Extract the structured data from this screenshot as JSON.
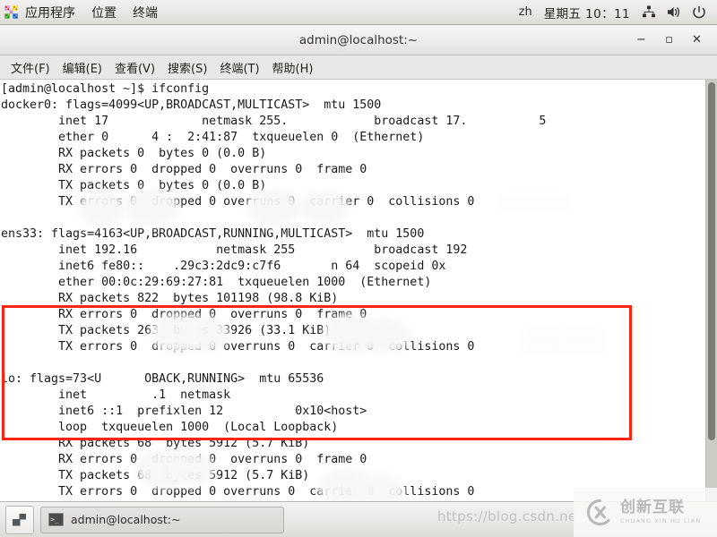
{
  "top_panel": {
    "apps_icon": "applications-pinwheel-icon",
    "menus": [
      "应用程序",
      "位置",
      "终端"
    ],
    "ime": "zh",
    "clock": "星期五 10：11",
    "tray": [
      {
        "name": "network-icon",
        "glyph": "network"
      },
      {
        "name": "volume-icon",
        "glyph": "volume"
      },
      {
        "name": "power-icon",
        "glyph": "power"
      }
    ]
  },
  "window": {
    "title": "admin@localhost:~",
    "controls": {
      "minimize": "−",
      "maximize": "▫",
      "close": "✕"
    },
    "menubar": [
      "文件(F)",
      "编辑(E)",
      "查看(V)",
      "搜索(S)",
      "终端(T)",
      "帮助(H)"
    ]
  },
  "terminal": {
    "prompt_line": "[admin@localhost ~]$ ifconfig",
    "lines": [
      "[admin@localhost ~]$ ifconfig",
      "docker0: flags=4099<UP,BROADCAST,MULTICAST>  mtu 1500",
      "        inet 17             netmask 255.            broadcast 17.          5",
      "        ether 0      4 :  2:41:87  txqueuelen 0  (Ethernet)",
      "        RX packets 0  bytes 0 (0.0 B)",
      "        RX errors 0  dropped 0  overruns 0  frame 0",
      "        TX packets 0  bytes 0 (0.0 B)",
      "        TX errors 0  dropped 0 overruns 0  carrier 0  collisions 0",
      "",
      "ens33: flags=4163<UP,BROADCAST,RUNNING,MULTICAST>  mtu 1500",
      "        inet 192.16           netmask 255           broadcast 192",
      "        inet6 fe80::    .29c3:2dc9:c7f6       n 64  scopeid 0x            ",
      "        ether 00:0c:29:69:27:81  txqueuelen 1000  (Ethernet)",
      "        RX packets 822  bytes 101198 (98.8 KiB)",
      "        RX errors 0  dropped 0  overruns 0  frame 0",
      "        TX packets 263  bytes 33926 (33.1 KiB)",
      "        TX errors 0  dropped 0 overruns 0  carrier 0  collisions 0",
      "",
      "lo: flags=73<U      OBACK,RUNNING>  mtu 65536",
      "        inet         .1  netmask             ",
      "        inet6 ::1  prefixlen 12          0x10<host>",
      "        loop  txqueuelen 1000  (Local Loopback)",
      "        RX packets 68  bytes 5912 (5.7 KiB)",
      "        RX errors 0  dropped 0  overruns 0  frame 0",
      "        TX packets 68  bytes 5912 (5.7 KiB)",
      "        TX errors 0  dropped 0 overruns 0  carrier 0  collisions 0"
    ],
    "highlight": {
      "color": "#fe2510",
      "target_interface": "ens33"
    }
  },
  "taskbar": {
    "workspace_icon": "workspace-switcher-icon",
    "task_label": "admin@localhost:~",
    "task_icon": "terminal-icon"
  },
  "watermarks": {
    "url": "https://blog.csdn.ne",
    "logo_cn": "创新互联",
    "logo_en": "CHUANG XIN HU LIAN"
  },
  "colors": {
    "highlight": "#fe2510",
    "panel_bg": "#e8e7e5",
    "terminal_bg": "#ffffff",
    "terminal_fg": "#1a1a1a"
  }
}
